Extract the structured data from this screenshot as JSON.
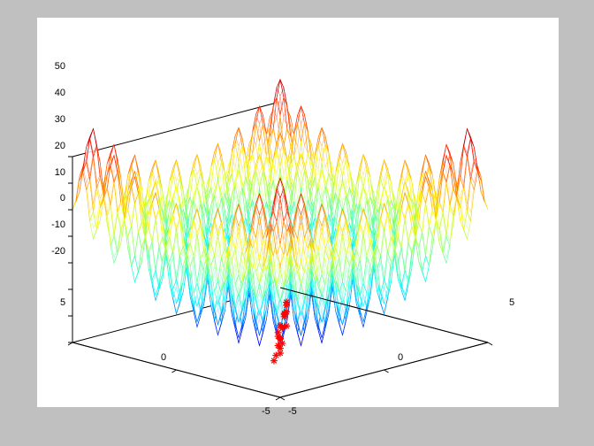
{
  "chart_data": {
    "type": "surface",
    "function": "Rastrigin (2D)",
    "x_range": [
      -5,
      5
    ],
    "y_range": [
      -5,
      5
    ],
    "z_range": [
      -20,
      50
    ],
    "x_ticks": [
      -5,
      0,
      5
    ],
    "y_ticks": [
      -5,
      0,
      5
    ],
    "z_ticks": [
      -20,
      -10,
      0,
      10,
      20,
      30,
      40,
      50
    ],
    "colormap": "jet",
    "style": "mesh",
    "scatter": {
      "marker": "*",
      "color": "#ff0000",
      "points": [
        {
          "x": -2.3,
          "y": -2.0,
          "z": -18
        },
        {
          "x": -2.0,
          "y": -1.8,
          "z": -17
        },
        {
          "x": -1.7,
          "y": -1.7,
          "z": -17
        },
        {
          "x": -1.5,
          "y": -1.5,
          "z": -16
        },
        {
          "x": -1.3,
          "y": -1.2,
          "z": -16
        },
        {
          "x": -1.0,
          "y": -1.1,
          "z": -16
        },
        {
          "x": -0.9,
          "y": -0.9,
          "z": -15
        },
        {
          "x": -0.8,
          "y": -0.8,
          "z": -15
        },
        {
          "x": -0.7,
          "y": -0.6,
          "z": -15
        },
        {
          "x": -0.6,
          "y": -0.5,
          "z": -14
        },
        {
          "x": -0.4,
          "y": -0.4,
          "z": -12
        },
        {
          "x": -0.2,
          "y": -0.3,
          "z": -13
        },
        {
          "x": -0.1,
          "y": -0.2,
          "z": -14
        },
        {
          "x": 0.2,
          "y": -0.1,
          "z": -14
        },
        {
          "x": 1.0,
          "y": 0.8,
          "z": -14
        },
        {
          "x": 1.2,
          "y": 1.0,
          "z": -14
        },
        {
          "x": 1.3,
          "y": 1.1,
          "z": -14
        },
        {
          "x": 1.5,
          "y": 1.2,
          "z": -14
        },
        {
          "x": 1.6,
          "y": 1.3,
          "z": -12
        },
        {
          "x": 1.4,
          "y": 1.1,
          "z": -10
        }
      ]
    }
  },
  "axes": {
    "x": {
      "range": [
        -5,
        5
      ],
      "ticks": [
        "-5",
        "0",
        "5"
      ]
    },
    "y": {
      "range": [
        -5,
        5
      ],
      "ticks": [
        "-5",
        "0",
        "5"
      ]
    },
    "z": {
      "range": [
        -20,
        50
      ],
      "ticks": [
        "-20",
        "-10",
        "0",
        "10",
        "20",
        "30",
        "40",
        "50"
      ]
    }
  }
}
